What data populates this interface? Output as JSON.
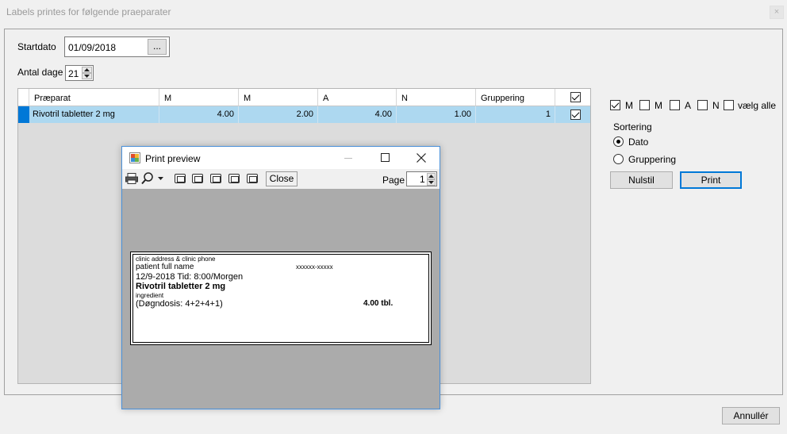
{
  "window": {
    "title": "Labels printes for følgende praeparater",
    "close_glyph": "×"
  },
  "form": {
    "startdato_label": "Startdato",
    "startdato_value": "01/09/2018",
    "browse_label": "...",
    "antal_dage_label": "Antal dage",
    "antal_dage_value": "21"
  },
  "grid": {
    "columns": [
      "Præparat",
      "M",
      "M",
      "A",
      "N",
      "Gruppering"
    ],
    "rows": [
      {
        "praeparat": "Rivotril tabletter 2 mg",
        "m1": "4.00",
        "m2": "2.00",
        "a": "4.00",
        "n": "1.00",
        "gruppering": "1",
        "checked": true
      }
    ],
    "selected_row_color": "#add8f0"
  },
  "filters": {
    "items": [
      {
        "label": "M",
        "checked": true
      },
      {
        "label": "M",
        "checked": false
      },
      {
        "label": "A",
        "checked": false
      },
      {
        "label": "N",
        "checked": false
      },
      {
        "label": "vælg alle",
        "checked": false
      }
    ]
  },
  "sorting": {
    "label": "Sortering",
    "options": [
      {
        "label": "Dato",
        "selected": true
      },
      {
        "label": "Gruppering",
        "selected": false
      }
    ]
  },
  "buttons": {
    "nulstil": "Nulstil",
    "print": "Print",
    "annuller": "Annullér"
  },
  "preview": {
    "title": "Print preview",
    "close_button": "Close",
    "page_label": "Page",
    "page_value": "1",
    "label": {
      "clinic": "clinic address & clinic phone",
      "patient": "patient full name",
      "cpr": "xxxxxx-xxxxx",
      "date_time": "12/9-2018 Tid: 8:00/Morgen",
      "drug": "Rivotril tabletter 2 mg",
      "ingredient": "ingredient",
      "dose": "(Døgndosis: 4+2+4+1)",
      "amount": "4.00 tbl."
    }
  }
}
